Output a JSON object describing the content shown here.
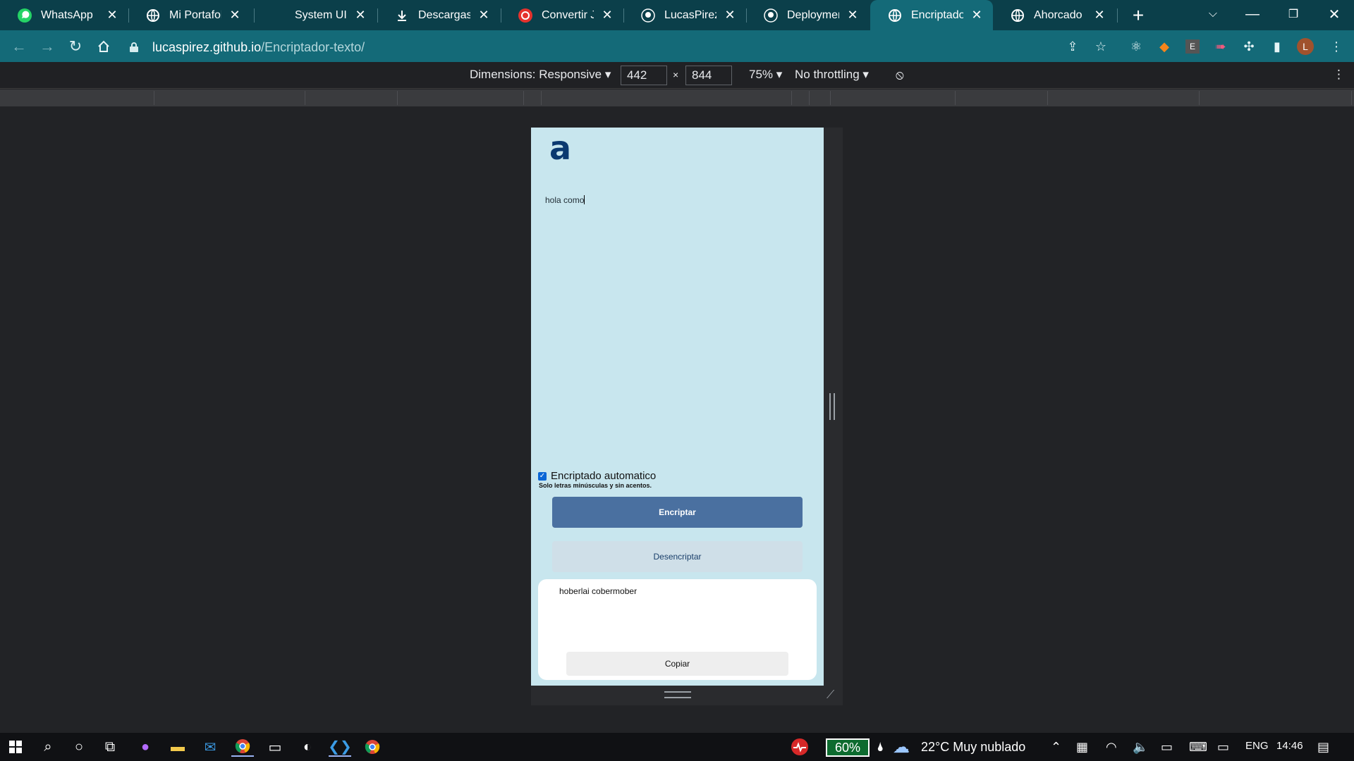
{
  "browser": {
    "tabs": [
      {
        "title": "WhatsApp",
        "icon": "whatsapp-icon",
        "active": false
      },
      {
        "title": "Mi Portafolio",
        "icon": "globe-icon",
        "active": false
      },
      {
        "title": "System UIcons",
        "icon": "blank-icon",
        "active": false
      },
      {
        "title": "Descargas",
        "icon": "download-icon",
        "active": false
      },
      {
        "title": "Convertir JPG",
        "icon": "pdf-converter-icon",
        "active": false
      },
      {
        "title": "LucasPirez/En",
        "icon": "github-icon",
        "active": false
      },
      {
        "title": "Deployments",
        "icon": "github-icon",
        "active": false
      },
      {
        "title": "Encriptador",
        "icon": "globe-icon",
        "active": true
      },
      {
        "title": "Ahorcado",
        "icon": "globe-icon",
        "active": false
      }
    ],
    "url_host": "lucaspirez.github.io",
    "url_path": "/Encriptador-texto/",
    "profile_initial": "L",
    "extension_label": "E"
  },
  "devtools": {
    "dimensions_label": "Dimensions: Responsive",
    "width": "442",
    "height": "844",
    "times": "×",
    "zoom": "75%",
    "throttling": "No throttling"
  },
  "app": {
    "logo": "a",
    "input_text": "hola como",
    "auto_encrypt_label": "Encriptado automatico",
    "auto_encrypt_checked": true,
    "hint": "Solo letras minúsculas y sin acentos.",
    "encrypt_button": "Encriptar",
    "decrypt_button": "Desencriptar",
    "output_text": "hoberlai cobermober",
    "copy_button": "Copiar",
    "colors": {
      "page_bg": "#c8e6ee",
      "primary_button": "#4a70a0",
      "secondary_button": "#cfdfe8",
      "logo": "#0b3970"
    }
  },
  "taskbar": {
    "battery": "60%",
    "weather": "22°C  Muy nublado",
    "language": "ENG",
    "time": "14:46"
  }
}
